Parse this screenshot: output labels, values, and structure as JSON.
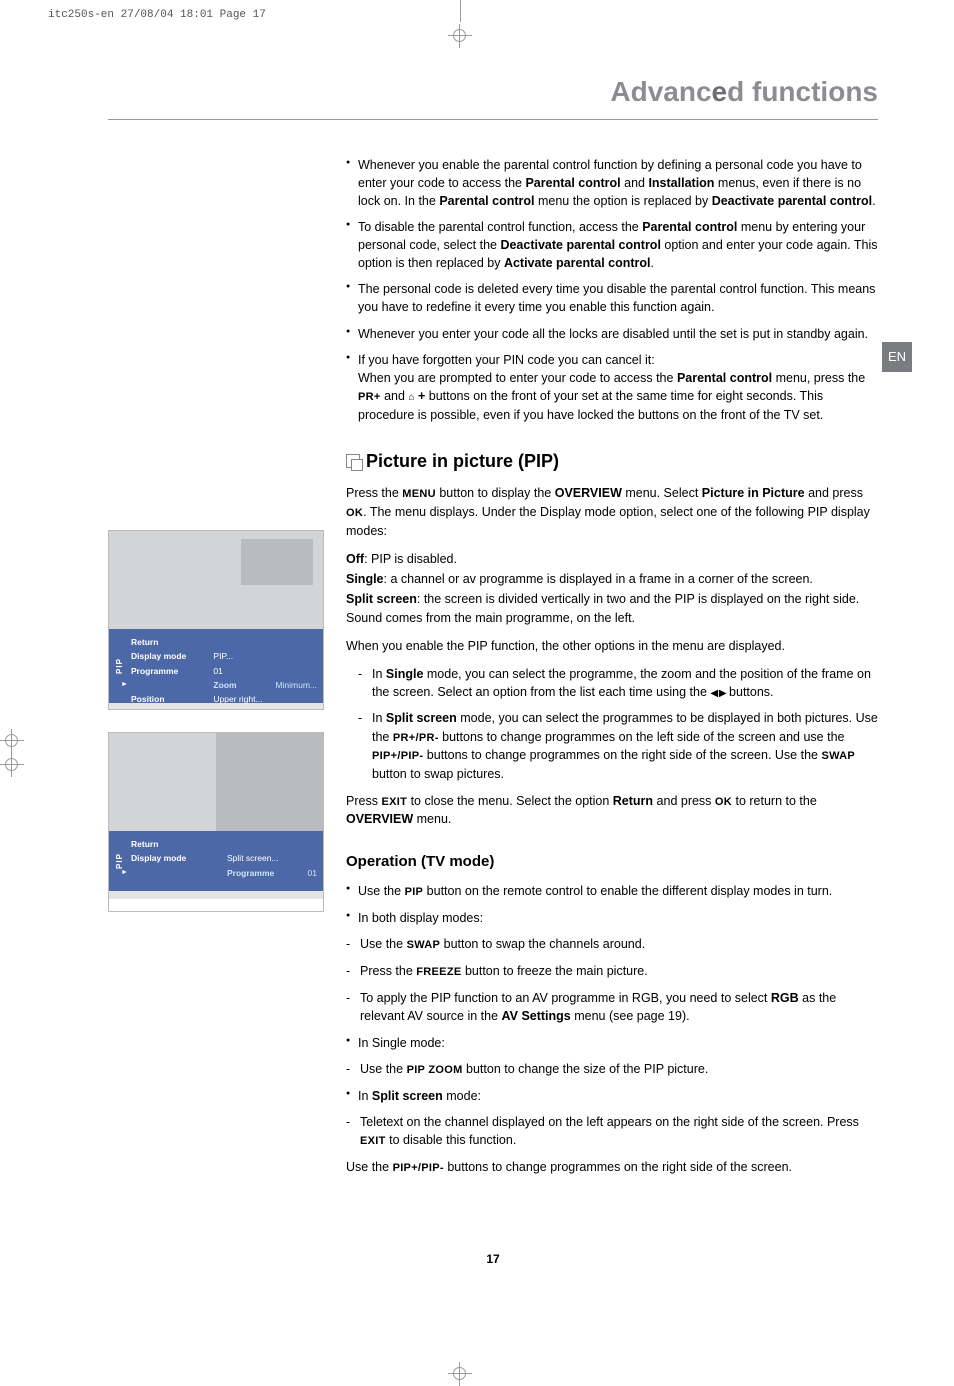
{
  "print_header": "itc250s-en  27/08/04  18:01  Page 17",
  "section_title_pre": "Advanc",
  "section_title_accent": "e",
  "section_title_post": "d functions",
  "lang": "EN",
  "page_number": "17",
  "bullets_top": {
    "b1": "Whenever you enable the parental control function by defining a personal code you have to enter your code to access the Parental control and Installation menus, even if there is no lock on. In the Parental control menu the option is replaced by Deactivate parental control.",
    "b2": "To disable the parental control function, access the Parental control menu by entering your personal code, select the Deactivate parental control option and enter your code again. This option is then replaced by Activate parental control.",
    "b3": "The personal code is deleted every time you disable the parental control function. This means you have to redefine it every time you enable this function again.",
    "b4": "Whenever you enter your code all the locks are disabled until the set is put in standby again.",
    "b5a": "If you have forgotten your PIN code you can cancel it:",
    "b5b": "When you are prompted to enter your code to access the Parental control menu, press the PR+ and ⌂ + buttons on the front of your set at the same time for eight seconds. This procedure is possible, even if you have locked the buttons on the front of the TV set."
  },
  "pip": {
    "heading": "Picture in picture (PIP)",
    "intro": "Press the MENU button to display the OVERVIEW menu. Select Picture in Picture and press OK. The menu displays. Under the Display mode option, select one of the following PIP display modes:",
    "off": "Off: PIP is disabled.",
    "single": "Single: a channel or av programme is displayed in a frame in a corner of the screen.",
    "split": "Split screen: the screen is divided vertically in two and the PIP is displayed on the right side. Sound comes from the main programme, on the left.",
    "enable": "When you enable the PIP function, the other options in the menu are displayed.",
    "d1": "In Single mode, you can select the programme, the zoom and the position of the frame on the screen. Select an option from the list each time using the ◀ ▶ buttons.",
    "d2": "In Split screen mode, you can select the programmes to be displayed in both pictures. Use the PR+/PR- buttons to change programmes on the left side of the screen and use the PIP+/PIP- buttons to change programmes on the right side of the screen. Use the SWAP button to swap pictures.",
    "exit": "Press EXIT to close the menu. Select the option Return and press OK to return to the OVERVIEW menu."
  },
  "op": {
    "heading": "Operation (TV mode)",
    "b1": "Use the PIP button on the remote control to enable the different display modes in turn.",
    "b2": "In both display modes:",
    "d1": "Use the SWAP button to swap the channels around.",
    "d2": "Press the FREEZE button to freeze the main picture.",
    "d3": "To apply the PIP function to an AV programme in RGB, you need to select RGB as the relevant AV source in the AV Settings menu (see page 19).",
    "b3": "In Single mode:",
    "d4": "Use the PIP ZOOM button to change the size of the PIP picture.",
    "b4": "In Split screen mode:",
    "d5": "Teletext on the channel displayed on the left appears on the right side of the screen. Press EXIT to disable this function.",
    "tail": "Use the PIP+/PIP- buttons to change programmes on the right side of the screen."
  },
  "fig1": {
    "vlabel": "PIP",
    "rows": [
      [
        "Return",
        ""
      ],
      [
        "Display mode",
        "PIP..."
      ],
      [
        "Programme",
        "01"
      ],
      [
        "Zoom",
        "Minimum..."
      ],
      [
        "Position",
        "Upper right..."
      ]
    ],
    "selected": 3
  },
  "fig2": {
    "vlabel": "PIP",
    "rows": [
      [
        "Return",
        ""
      ],
      [
        "Display mode",
        "Split screen..."
      ],
      [
        "Programme",
        "01"
      ]
    ],
    "selected": 2
  }
}
